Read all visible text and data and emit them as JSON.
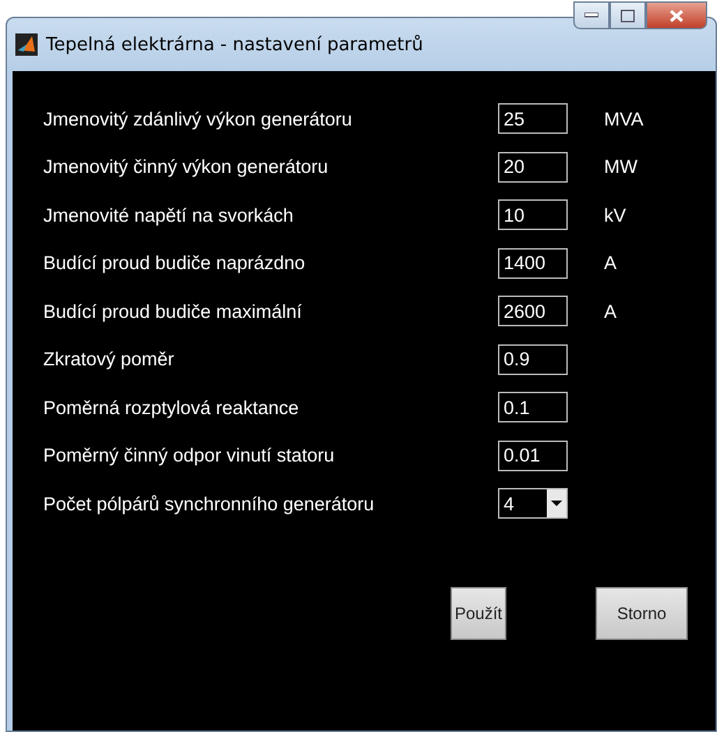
{
  "window": {
    "title": "Tepelná elektrárna - nastavení parametrů",
    "controls": [
      {
        "kind": "minimize"
      },
      {
        "kind": "maximize"
      },
      {
        "kind": "close"
      }
    ]
  },
  "parameters": [
    {
      "label": "Jmenovitý zdánlivý výkon generátoru",
      "kind": "field",
      "value": "25",
      "unit": "MVA"
    },
    {
      "label": "Jmenovitý činný výkon generátoru",
      "kind": "field",
      "value": "20",
      "unit": "MW"
    },
    {
      "label": "Jmenovité napětí na svorkách",
      "kind": "field",
      "value": "10",
      "unit": "kV"
    },
    {
      "label": "Budící proud budiče naprázdno",
      "kind": "field",
      "value": "1400",
      "unit": "A"
    },
    {
      "label": "Budící proud budiče maximální",
      "kind": "field",
      "value": "2600",
      "unit": "A"
    },
    {
      "label": "Zkratový poměr",
      "kind": "field",
      "value": "0.9"
    },
    {
      "label": "Poměrná rozptylová reaktance",
      "kind": "field",
      "value": "0.1"
    },
    {
      "label": "Poměrný činný odpor vinutí statoru",
      "kind": "field",
      "value": "0.01"
    },
    {
      "label": "Počet pólpárů synchronního generátoru",
      "kind": "dropdown",
      "value": "4"
    }
  ],
  "buttons": [
    "Použít",
    "Storno"
  ]
}
